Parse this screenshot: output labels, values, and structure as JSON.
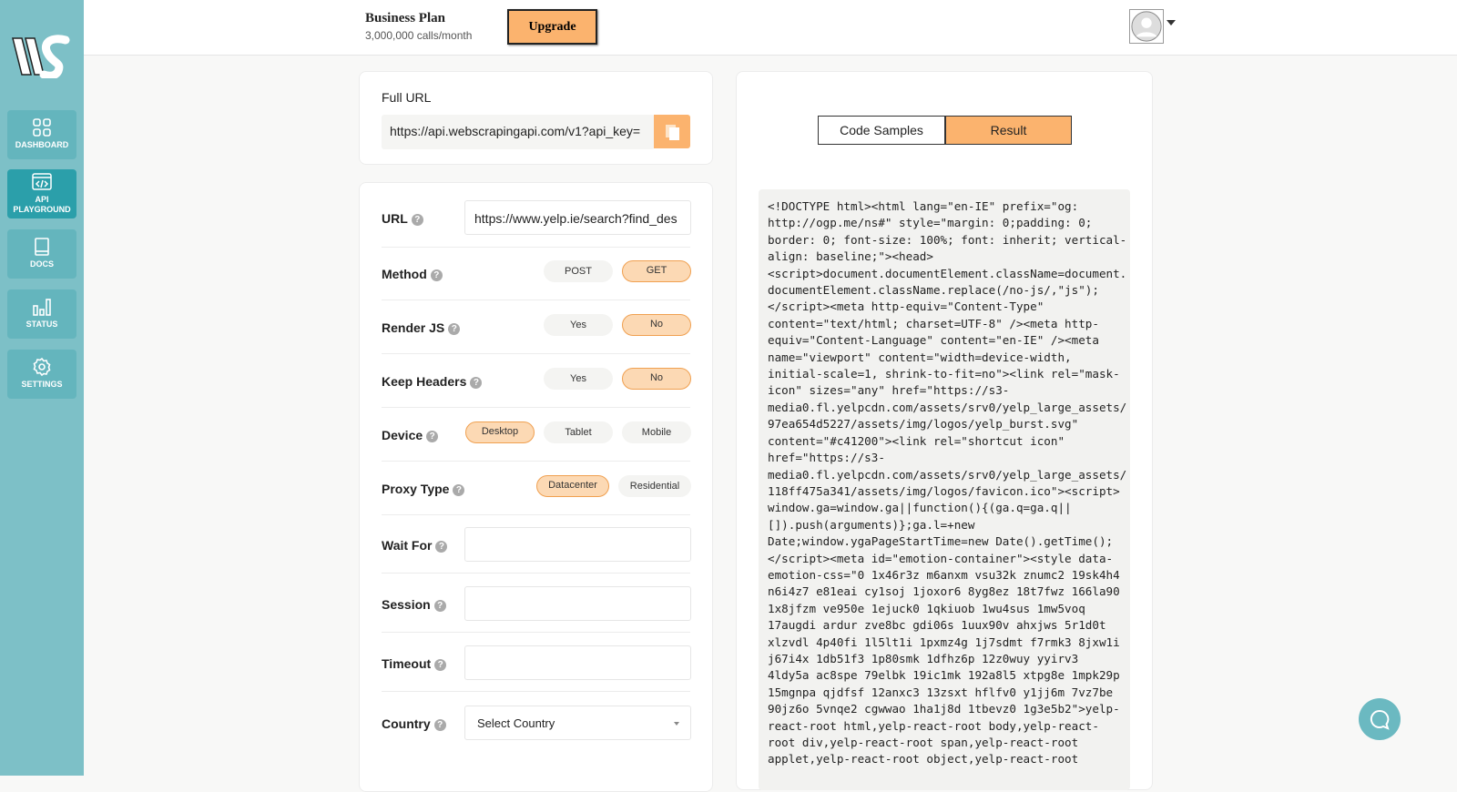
{
  "sidebar": {
    "items": [
      {
        "label": "DASHBOARD",
        "icon": "grid-icon"
      },
      {
        "label": "API PLAYGROUND",
        "icon": "code-window-icon",
        "active": true
      },
      {
        "label": "DOCS",
        "icon": "book-icon"
      },
      {
        "label": "STATUS",
        "icon": "bar-chart-icon"
      },
      {
        "label": "SETTINGS",
        "icon": "gear-icon"
      }
    ]
  },
  "header": {
    "plan_title": "Business Plan",
    "plan_sub": "3,000,000 calls/month",
    "upgrade_label": "Upgrade"
  },
  "full_url": {
    "label": "Full URL",
    "value": "https://api.webscrapingapi.com/v1?api_key="
  },
  "form": {
    "url": {
      "label": "URL",
      "value": "https://www.yelp.ie/search?find_des"
    },
    "method": {
      "label": "Method",
      "options": [
        "POST",
        "GET"
      ],
      "selected": "GET"
    },
    "render_js": {
      "label": "Render JS",
      "options": [
        "Yes",
        "No"
      ],
      "selected": "No"
    },
    "keep_headers": {
      "label": "Keep Headers",
      "options": [
        "Yes",
        "No"
      ],
      "selected": "No"
    },
    "device": {
      "label": "Device",
      "options": [
        "Desktop",
        "Tablet",
        "Mobile"
      ],
      "selected": "Desktop"
    },
    "proxy_type": {
      "label": "Proxy Type",
      "options": [
        "Datacenter",
        "Residential"
      ],
      "selected": "Datacenter"
    },
    "wait_for": {
      "label": "Wait For",
      "value": ""
    },
    "session": {
      "label": "Session",
      "value": ""
    },
    "timeout": {
      "label": "Timeout",
      "value": ""
    },
    "country": {
      "label": "Country",
      "value": "Select Country"
    }
  },
  "tabs": {
    "code_samples": "Code Samples",
    "result": "Result",
    "active": "Result"
  },
  "result_code": "<!DOCTYPE html><html lang=\"en-IE\" prefix=\"og:\nhttp://ogp.me/ns#\" style=\"margin: 0;padding: 0;\nborder: 0; font-size: 100%; font: inherit; vertical-\nalign: baseline;\"><head>\n<script>document.documentElement.className=document.\ndocumentElement.className.replace(/no-js/,\"js\");\n</script><meta http-equiv=\"Content-Type\"\ncontent=\"text/html; charset=UTF-8\" /><meta http-\nequiv=\"Content-Language\" content=\"en-IE\" /><meta\nname=\"viewport\" content=\"width=device-width,\ninitial-scale=1, shrink-to-fit=no\"><link rel=\"mask-\nicon\" sizes=\"any\" href=\"https://s3-\nmedia0.fl.yelpcdn.com/assets/srv0/yelp_large_assets/\n97ea654d5227/assets/img/logos/yelp_burst.svg\"\ncontent=\"#c41200\"><link rel=\"shortcut icon\"\nhref=\"https://s3-\nmedia0.fl.yelpcdn.com/assets/srv0/yelp_large_assets/\n118ff475a341/assets/img/logos/favicon.ico\"><script>\nwindow.ga=window.ga||function(){(ga.q=ga.q||\n[]).push(arguments)};ga.l=+new\nDate;window.ygaPageStartTime=new Date().getTime();\n</script><meta id=\"emotion-container\"><style data-\nemotion-css=\"0 1x46r3z m6anxm vsu32k znumc2 19sk4h4\nn6i4z7 e81eai cy1soj 1joxor6 8yg8ez 18t7fwz 166la90\n1x8jfzm ve950e 1ejuck0 1qkiuob 1wu4sus 1mw5voq\n17augdi ardur zve8bc gdi06s 1uux90v ahxjws 5r1d0t\nxlzvdl 4p40fi 1l5lt1i 1pxmz4g 1j7sdmt f7rmk3 8jxw1i\nj67i4x 1db51f3 1p80smk 1dfhz6p 12z0wuy yyirv3\n4ldy5a ac8spe 79elbk 19ic1mk 192a8l5 xtpg8e 1mpk29p\n15mgnpa qjdfsf 12anxc3 13zsxt hflfv0 y1jj6m 7vz7be\n90jz6o 5vnqe2 cgwwao 1ha1j8d 1tbevz0 1g3e5b2\">yelp-\nreact-root html,yelp-react-root body,yelp-react-\nroot div,yelp-react-root span,yelp-react-root\napplet,yelp-react-root object,yelp-react-root",
  "colors": {
    "sidebar": "#7dc0c7",
    "active_nav": "#2b9faa",
    "accent": "#fbb36e",
    "pill_on": "#fcd9b4"
  }
}
